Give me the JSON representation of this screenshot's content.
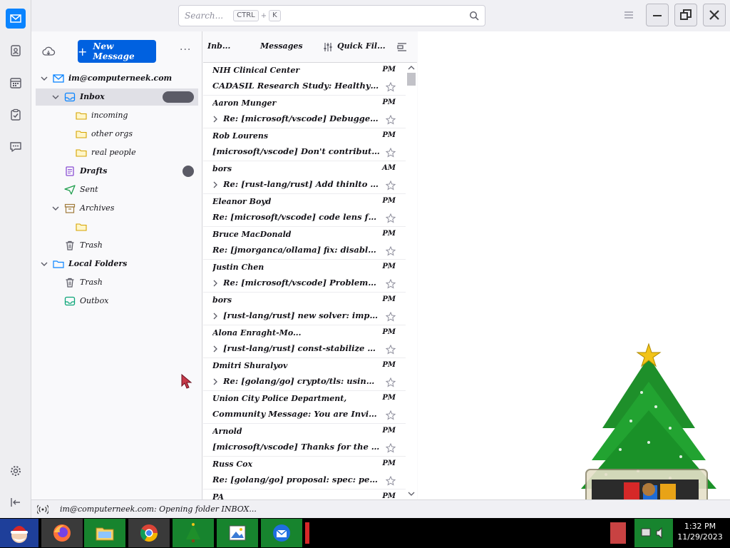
{
  "search": {
    "placeholder": "Search...",
    "key1": "CTRL",
    "key2": "K"
  },
  "folderpane": {
    "new_message": "New Message",
    "more": "···",
    "folders": [
      {
        "label": "im@computerneek.com"
      },
      {
        "label": "Inbox",
        "badge": ""
      },
      {
        "label": "incoming"
      },
      {
        "label": "other orgs"
      },
      {
        "label": "real people"
      },
      {
        "label": "Drafts",
        "badge": ""
      },
      {
        "label": "Sent"
      },
      {
        "label": "Archives"
      },
      {
        "label": ""
      },
      {
        "label": "Trash"
      },
      {
        "label": "Local Folders"
      },
      {
        "label": "Trash"
      },
      {
        "label": "Outbox"
      }
    ]
  },
  "listhead": {
    "title": "Inb...",
    "count": "Messages",
    "quickfilter": "Quick Fil..."
  },
  "messages": [
    {
      "sender": "NIH Clinical Center",
      "time": "PM",
      "subject": "CADASIL Research Study: Healthy ...",
      "indent": false
    },
    {
      "sender": "Aaron Munger",
      "time": "PM",
      "subject": "Re: [microsoft/vscode] Debugger console...",
      "indent": true
    },
    {
      "sender": "Rob Lourens",
      "time": "PM",
      "subject": "[microsoft/vscode] Don't contribute the Problem...",
      "indent": false
    },
    {
      "sender": "bors",
      "time": "AM",
      "subject": "Re: [rust-lang/rust] Add thinlto support to ...",
      "indent": true
    },
    {
      "sender": "Eleanor Boyd",
      "time": "PM",
      "subject": "Re: [microsoft/vscode] code lens for TypeS...",
      "indent": false
    },
    {
      "sender": "Bruce MacDonald",
      "time": "PM",
      "subject": "Re: [jmorganca/ollama] fix: disable ':' in tag...",
      "indent": false
    },
    {
      "sender": "Justin Chen",
      "time": "PM",
      "subject": "Re: [microsoft/vscode] Problems warning st...",
      "indent": true
    },
    {
      "sender": "bors",
      "time": "PM",
      "subject": "[rust-lang/rust] new solver: improve coinductive...",
      "indent": true
    },
    {
      "sender": "Alona Enraght-Mo...",
      "time": "PM",
      "subject": "[rust-lang/rust] const-stabilize HashMap/...",
      "indent": true
    },
    {
      "sender": "Dmitri Shuralyov",
      "time": "PM",
      "subject": "Re: [golang/go] crypto/tls: using a...",
      "indent": true
    },
    {
      "sender": "Union City Police Department, GA",
      "time": "PM",
      "subject": "Community Message: You are Invited to U...",
      "indent": false
    },
    {
      "sender": "Arnold",
      "time": "PM",
      "subject": "[microsoft/vscode] Thanks for the suggestions...",
      "indent": false
    },
    {
      "sender": "Russ Cox",
      "time": "PM",
      "subject": "Re: [golang/go] proposal: spec: permit using...",
      "indent": false
    },
    {
      "sender": "PA",
      "time": "PM",
      "subject": "",
      "indent": false
    }
  ],
  "status": {
    "text": "im@computerneek.com: Opening folder INBOX..."
  },
  "clock": {
    "time": "1:32 PM",
    "date": "11/29/2023"
  }
}
